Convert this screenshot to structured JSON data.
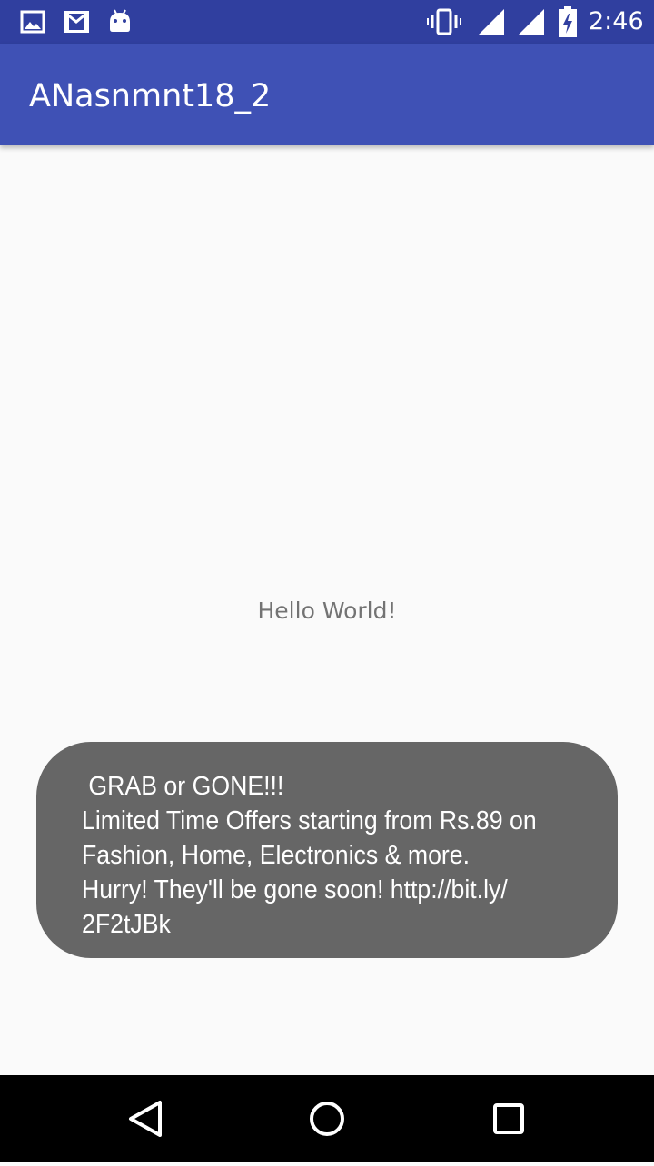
{
  "status_bar": {
    "time": "2:46",
    "icons_left": [
      "image-notification-icon",
      "gmail-notification-icon",
      "android-notification-icon"
    ],
    "icons_right": [
      "vibrate-icon",
      "signal-icon",
      "wifi-signal-icon",
      "battery-charging-icon"
    ]
  },
  "app_bar": {
    "title": "ANasnmnt18_2"
  },
  "main": {
    "hello_text": "Hello World!"
  },
  "toast": {
    "lines": [
      " GRAB or GONE!!!",
      "Limited Time Offers starting from Rs.89 on",
      "Fashion, Home, Electronics & more.",
      "Hurry! They'll be gone soon! http://bit.ly/",
      "2F2tJBk"
    ]
  },
  "nav_bar": {
    "buttons": [
      "back-icon",
      "home-icon",
      "recents-icon"
    ]
  },
  "colors": {
    "status_bar": "#303f9f",
    "app_bar": "#3f51b5",
    "background": "#fafafa",
    "toast": "#666666",
    "nav_bar": "#000000"
  }
}
